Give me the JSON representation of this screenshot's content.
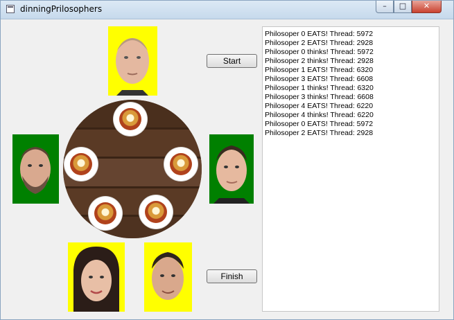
{
  "window": {
    "title": "dinningPrilosophers"
  },
  "buttons": {
    "start": "Start",
    "finish": "Finish"
  },
  "log": [
    "Philosoper 0 EATS! Thread: 5972",
    "Philosoper 2 EATS! Thread: 2928",
    "Philosoper 0 thinks! Thread: 5972",
    "Philosoper 2 thinks! Thread: 2928",
    "Philosoper 1 EATS! Thread: 6320",
    "Philosoper 3 EATS! Thread: 6608",
    "Philosoper 1 thinks! Thread: 6320",
    "Philosoper 3 thinks! Thread: 6608",
    "Philosoper 4 EATS! Thread: 6220",
    "Philosoper 4 thinks! Thread: 6220",
    "Philosoper 0 EATS! Thread: 5972",
    "Philosoper 2 EATS! Thread: 2928"
  ],
  "colors": {
    "eating": "#ffff00",
    "waiting": "#008000",
    "table": "#5a3a25"
  }
}
